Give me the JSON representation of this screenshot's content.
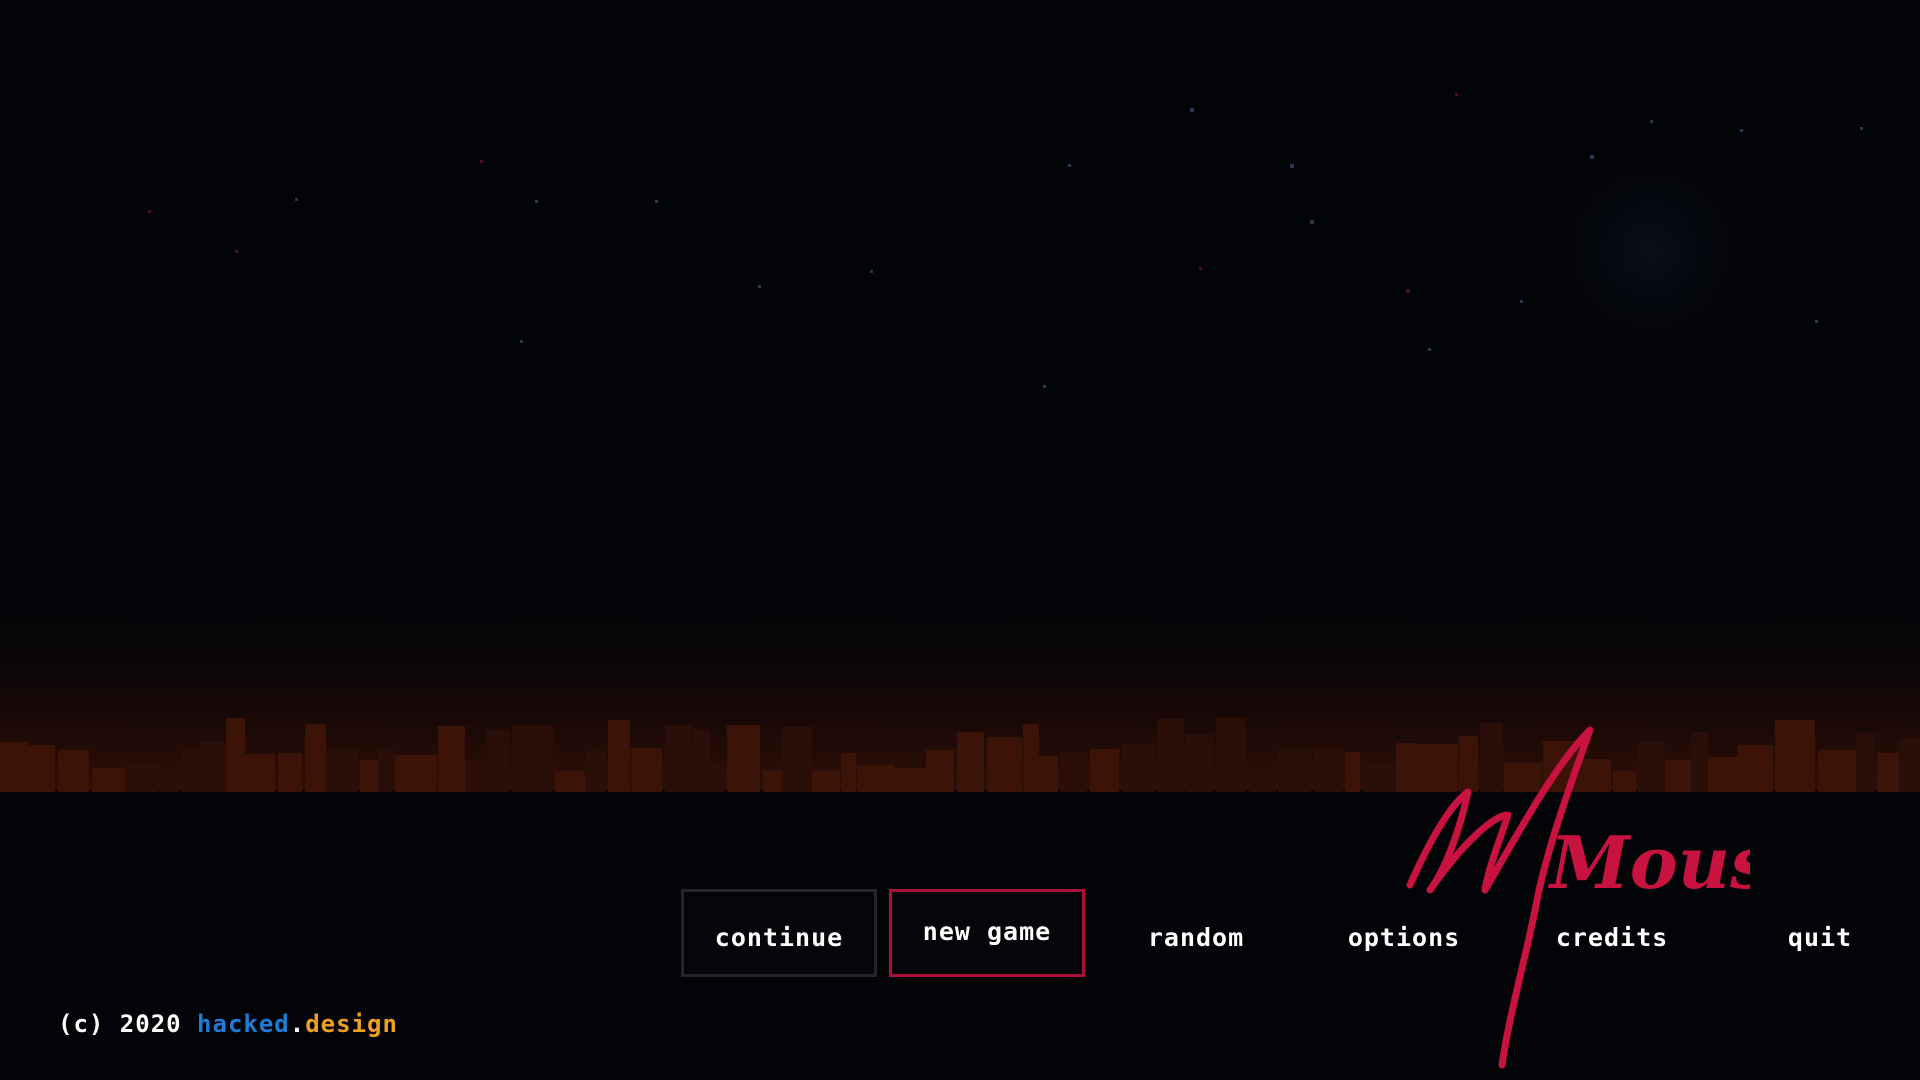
{
  "menu": {
    "items": [
      {
        "id": "continue",
        "label": "continue",
        "style": "dark"
      },
      {
        "id": "new-game",
        "label": "new game",
        "style": "selected"
      },
      {
        "id": "random",
        "label": "random",
        "style": "plain"
      },
      {
        "id": "options",
        "label": "options",
        "style": "plain"
      },
      {
        "id": "credits",
        "label": "credits",
        "style": "plain"
      },
      {
        "id": "quit",
        "label": "quit",
        "style": "plain"
      }
    ]
  },
  "logo": {
    "text": "Mouse",
    "color": "#c8123f"
  },
  "footer": {
    "prefix": "(c) 2020 ",
    "brand_part1": "hacked",
    "brand_dot": ".",
    "brand_part2": "design",
    "brand_part1_color": "#1e7bd6",
    "brand_part2_color": "#f0a020"
  },
  "colors": {
    "background": "#030408",
    "skyline": "#2a0f08",
    "skyline_glow": "#3b1307",
    "star": "#2a3550",
    "star_red": "#4a1020",
    "selected_border": "#a8123a",
    "dark_border": "#25262c"
  }
}
